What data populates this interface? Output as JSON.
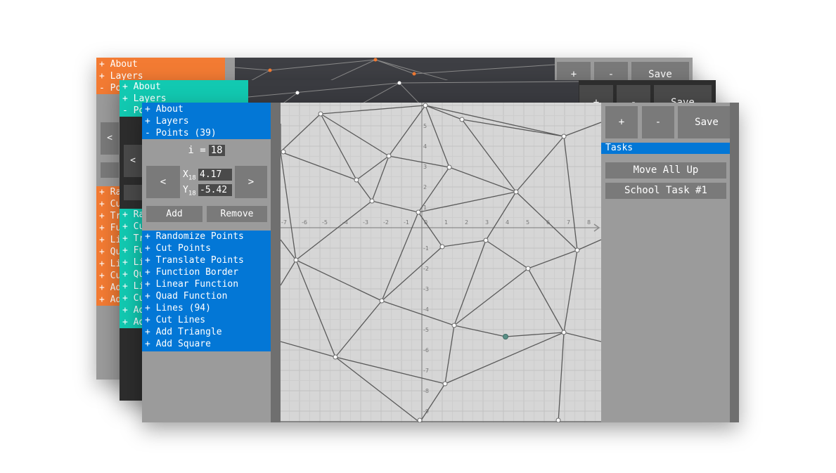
{
  "window_back": {
    "top_menu": [
      "+ About",
      "+ Layers",
      "- Po"
    ],
    "bottom_menu": [
      "+ Ra",
      "+ Cu",
      "+ Tr",
      "+ Fu",
      "+ Li",
      "+ Qu",
      "+ Li",
      "+ Cu",
      "+ Ad",
      "+ Ad"
    ],
    "buttons": {
      "plus": "+",
      "minus": "-",
      "save": "Save"
    },
    "prev": "<",
    "accent": "#f37b33"
  },
  "window_middle": {
    "top_menu": [
      "+ About",
      "+ Layers",
      "- Po"
    ],
    "bottom_menu": [
      "+ Ra",
      "+ Cu",
      "+ Tr",
      "+ Fu",
      "+ Li",
      "+ Qu",
      "+ Li",
      "+ Cu",
      "+ Ad",
      "+ Ad"
    ],
    "buttons": {
      "plus": "+",
      "minus": "-",
      "save": "Save"
    },
    "prev": "<",
    "accent": "#12c9b1"
  },
  "window_front": {
    "accent": "#0377d6",
    "top_menu": [
      "+ About",
      "+ Layers",
      "- Points (39)"
    ],
    "index": {
      "label": "i =",
      "value": "18"
    },
    "nav": {
      "prev": "<",
      "next": ">"
    },
    "coords": {
      "x_label": "X",
      "y_label": "Y",
      "subscript": "18",
      "x_value": "4.17",
      "y_value": "-5.42"
    },
    "actions": {
      "add": "Add",
      "remove": "Remove"
    },
    "bottom_menu": [
      "+ Randomize Points",
      "+ Cut Points",
      "+ Translate Points",
      "+ Function Border",
      "+ Linear Function",
      "+ Quad Function",
      "+ Lines (94)",
      "+ Cut Lines",
      "+ Add Triangle",
      "+ Add Square"
    ],
    "buttons": {
      "plus": "+",
      "minus": "-",
      "save": "Save"
    },
    "tasks_header": "Tasks",
    "tasks": [
      "Move All Up",
      "School Task #1"
    ],
    "graph": {
      "x_ticks": [
        "-7",
        "-6",
        "-5",
        "-4",
        "-3",
        "-2",
        "-1",
        "0",
        "1",
        "2",
        "3",
        "4",
        "5",
        "6",
        "7",
        "8"
      ],
      "y_ticks_pos": [
        "5",
        "4",
        "3",
        "2",
        "1"
      ],
      "y_ticks_neg": [
        "-1",
        "-2",
        "-3",
        "-4",
        "-5",
        "-6",
        "-7",
        "-8",
        "-9"
      ],
      "selected_point": {
        "index": 18,
        "x": 4.17,
        "y": -5.42
      }
    }
  }
}
